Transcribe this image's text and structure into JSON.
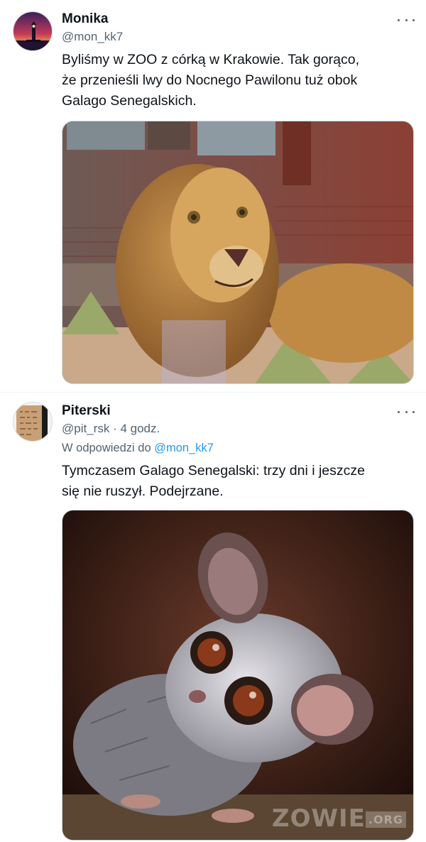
{
  "tweet1": {
    "name": "Monika",
    "handle": "@mon_kk7",
    "text_lines": [
      "Byliśmy w ZOO z córką w Krakowie. Tak gorąco,",
      "że przenieśli lwy do Nocnego Pawilonu tuż obok",
      "Galago Senegalskich."
    ],
    "avatar_icon": "lighthouse-sunset-avatar",
    "media_icon": "stuffed-lion-photo"
  },
  "tweet2": {
    "name": "Piterski",
    "handle": "@pit_rsk",
    "separator": "·",
    "time": "4 godz.",
    "reply_prefix": "W odpowiedzi do",
    "reply_handle": "@mon_kk7",
    "text_lines": [
      "Tymczasem Galago Senegalski: trzy dni i jeszcze",
      "się nie ruszył. Podejrzane."
    ],
    "avatar_icon": "stone-tablet-avatar",
    "media_icon": "galago-photo",
    "watermark": "ZOWIE",
    "watermark_suffix": ".ORG"
  },
  "colors": {
    "text": "#0f1419",
    "secondary": "#536471",
    "link": "#1d9bf0",
    "border": "#cfd9de"
  }
}
